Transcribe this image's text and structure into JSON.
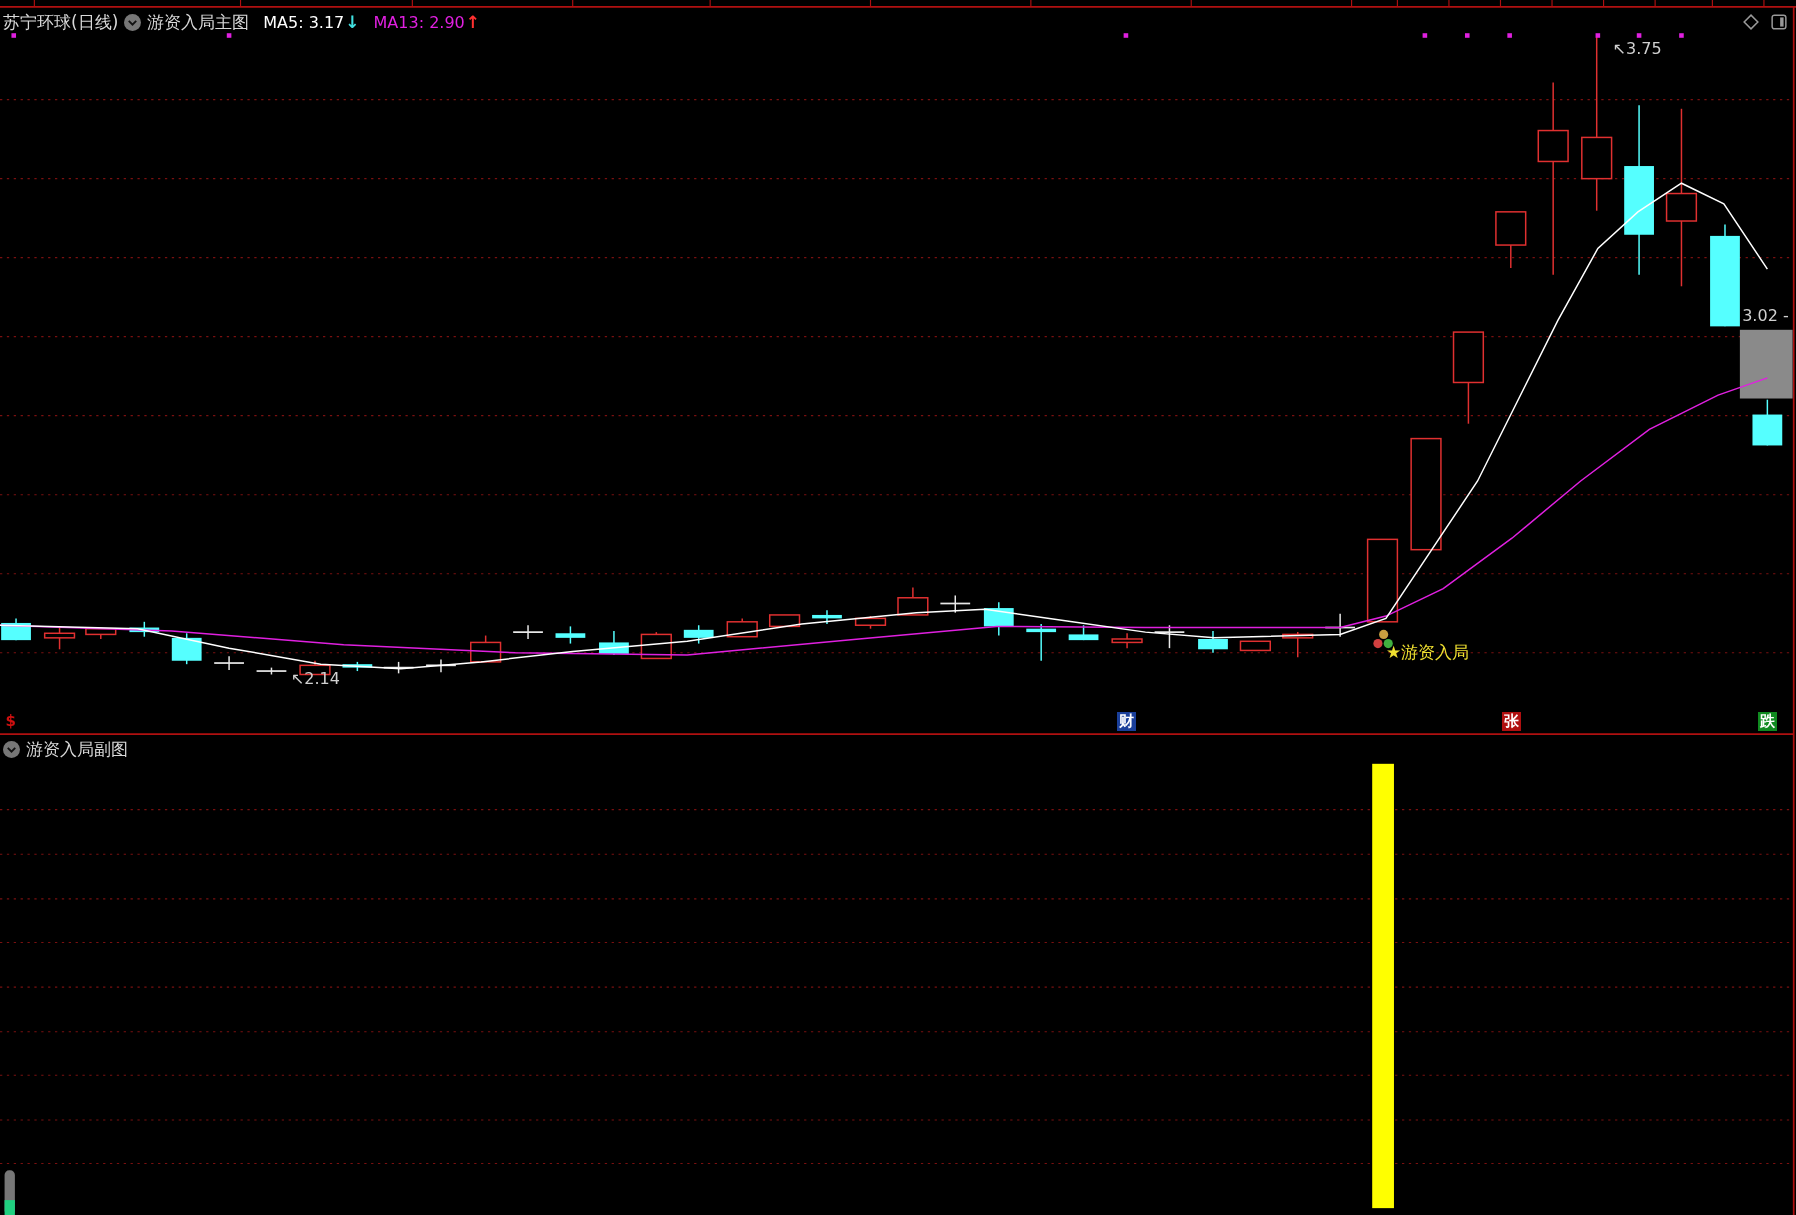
{
  "main_chart": {
    "title": "苏宁环球(日线)",
    "indicator": "游资入局主图",
    "moving_averages": [
      {
        "label": "MA5: 3.17",
        "arrow": "↓",
        "kind": "falling",
        "color": "#ffffff"
      },
      {
        "label": "MA13: 2.90",
        "arrow": "↑",
        "kind": "rising",
        "color": "#e020e0"
      }
    ],
    "price_labels": [
      {
        "kind": "high",
        "text": "↖3.75"
      },
      {
        "kind": "low",
        "text": "↖2.14"
      },
      {
        "kind": "current",
        "text": "3.02 -"
      }
    ],
    "signal_label": "★游资入局",
    "markers": [
      {
        "text": "$",
        "color": "#d01010"
      },
      {
        "text": "财",
        "color": "#1a3f9a"
      },
      {
        "text": "张",
        "color": "#b01010"
      },
      {
        "text": "跌",
        "color": "#108a20"
      }
    ]
  },
  "sub_chart": {
    "title": "游资入局副图"
  }
}
